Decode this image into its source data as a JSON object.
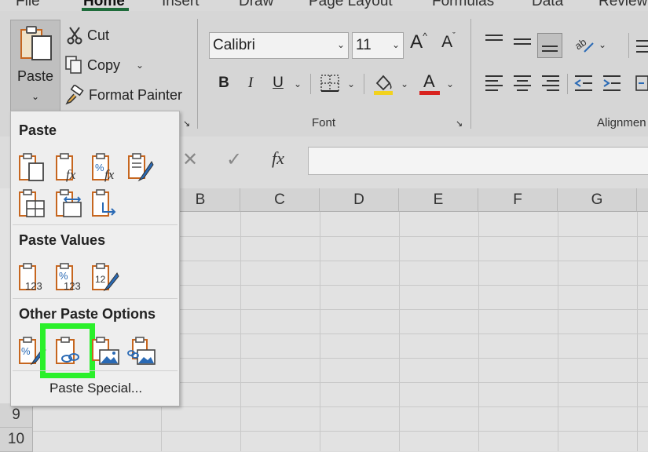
{
  "tabs": [
    "File",
    "Home",
    "Insert",
    "Draw",
    "Page Layout",
    "Formulas",
    "Data",
    "Review"
  ],
  "clipboard": {
    "paste_label": "Paste",
    "cut_label": "Cut",
    "copy_label": "Copy",
    "format_painter_label": "Format Painter"
  },
  "font": {
    "font_name": "Calibri",
    "font_size": "11",
    "group_label": "Font",
    "bold": "B",
    "italic": "I",
    "underline": "U",
    "increase_font": "A",
    "decrease_font": "A",
    "font_color_letter": "A"
  },
  "alignment": {
    "group_label": "Alignmen"
  },
  "formula_bar": {
    "fx_label": "fx"
  },
  "grid": {
    "columns": [
      "B",
      "C",
      "D",
      "E",
      "F",
      "G"
    ],
    "rows": [
      "9",
      "10"
    ]
  },
  "paste_menu": {
    "section_paste": "Paste",
    "section_values": "Paste Values",
    "section_other": "Other Paste Options",
    "paste_special_label": "Paste Special...",
    "values_icon_text": "123",
    "percent_symbol": "%",
    "fx_text": "fx"
  },
  "colors": {
    "accent_green": "#1e6b3a",
    "highlight": "#2af02a",
    "clipboard_orange": "#c6661f",
    "link_blue": "#2a6ab5",
    "fill_yellow": "#f2d21e",
    "font_red": "#d8231f"
  }
}
